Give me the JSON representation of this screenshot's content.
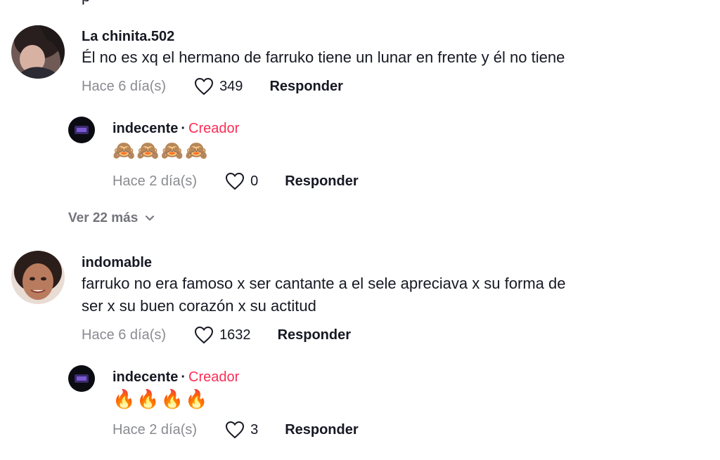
{
  "top_cut_text": "p",
  "comments": [
    {
      "username": "La chinita.502",
      "text": "Él no es xq el hermano de farruko tiene un lunar en frente y él no tiene",
      "time": "Hace 6 día(s)",
      "likes": "349",
      "reply_label": "Responder",
      "reply": {
        "username": "indecente",
        "separator": "·",
        "badge": "Creador",
        "text": "🙈🙈🙈🙈",
        "time": "Hace 2 día(s)",
        "likes": "0",
        "reply_label": "Responder"
      }
    },
    {
      "username": "indomable",
      "text_line1": "farruko no era famoso x ser cantante a el sele apreciava x su forma de",
      "text_line2": "ser x su buen corazón x su actitud",
      "time": "Hace 6 día(s)",
      "likes": "1632",
      "reply_label": "Responder",
      "reply": {
        "username": "indecente",
        "separator": "·",
        "badge": "Creador",
        "text": "🔥🔥🔥🔥",
        "time": "Hace 2 día(s)",
        "likes": "3",
        "reply_label": "Responder"
      }
    }
  ],
  "view_more_label": "Ver 22 más",
  "icons": {
    "like": "heart-outline-icon",
    "expand": "chevron-down-icon"
  },
  "colors": {
    "creator_badge": "#fe2c55",
    "muted_text": "#8a8b91",
    "primary_text": "#161823"
  }
}
